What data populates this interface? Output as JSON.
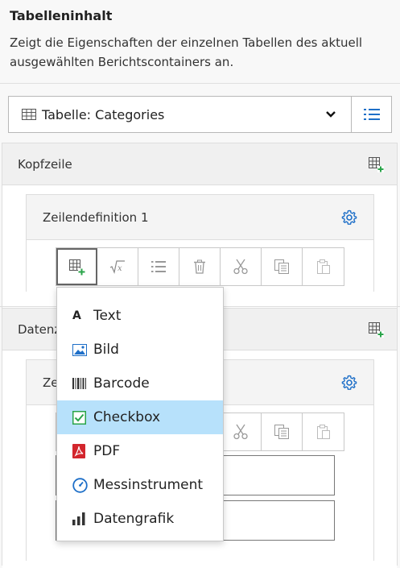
{
  "panel": {
    "title": "Tabelleninhalt",
    "description": "Zeigt die Eigenschaften der einzelnen Tabellen des aktuell ausgewählten Berichtscontainers an."
  },
  "table_selector": {
    "label": "Tabelle: Categories"
  },
  "sections": [
    {
      "title": "Kopfzeile",
      "row_definition": "Zeilendefinition 1"
    },
    {
      "title": "Datenz",
      "row_definition": "Ze"
    }
  ],
  "toolbar": {
    "buttons": [
      "add-cell-icon",
      "formula-icon",
      "list-icon",
      "trash-icon",
      "scissors-icon",
      "copy-icon",
      "paste-icon"
    ]
  },
  "add_menu": {
    "items": [
      {
        "label": "Text",
        "icon": "text-icon"
      },
      {
        "label": "Bild",
        "icon": "image-icon"
      },
      {
        "label": "Barcode",
        "icon": "barcode-icon"
      },
      {
        "label": "Checkbox",
        "icon": "checkbox-icon",
        "selected": true
      },
      {
        "label": "PDF",
        "icon": "pdf-icon"
      },
      {
        "label": "Messinstrument",
        "icon": "gauge-icon"
      },
      {
        "label": "Datengrafik",
        "icon": "chart-icon"
      }
    ]
  },
  "colors": {
    "accent": "#1e6fc8",
    "selection": "#b7e1fb",
    "green": "#2aa44a",
    "pdf_red": "#d3262d"
  }
}
